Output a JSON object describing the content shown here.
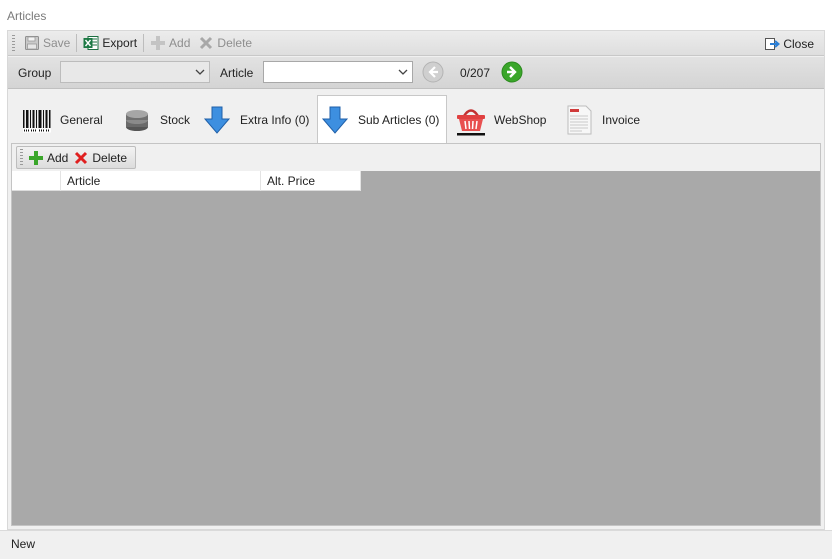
{
  "window": {
    "title": "Articles"
  },
  "toolbar": {
    "save_label": "Save",
    "export_label": "Export",
    "add_label": "Add",
    "delete_label": "Delete",
    "close_label": "Close"
  },
  "filter": {
    "group_label": "Group",
    "group_value": "",
    "article_label": "Article",
    "article_value": "",
    "record_counter": "0/207"
  },
  "tabs": [
    {
      "label": "General",
      "icon": "barcode-icon"
    },
    {
      "label": "Stock",
      "icon": "database-icon"
    },
    {
      "label": "Extra Info (0)",
      "icon": "arrow-down-icon"
    },
    {
      "label": "Sub Articles (0)",
      "icon": "arrow-down-icon",
      "active": true
    },
    {
      "label": "WebShop",
      "icon": "basket-icon"
    },
    {
      "label": "Invoice",
      "icon": "invoice-icon"
    }
  ],
  "subarticles": {
    "add_label": "Add",
    "delete_label": "Delete",
    "columns": [
      "",
      "Article",
      "Alt. Price"
    ],
    "rows": []
  },
  "status": {
    "text": "New"
  },
  "colors": {
    "accent_blue": "#2b7fd6",
    "green_arrow": "#3aa62a",
    "delete_red": "#e02020",
    "grid_background": "#a9a9a9"
  }
}
